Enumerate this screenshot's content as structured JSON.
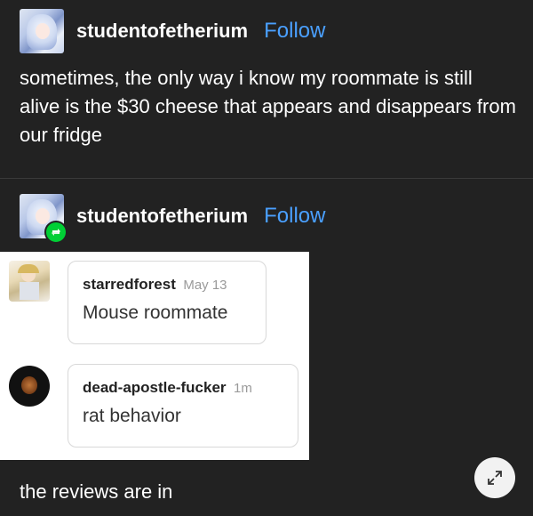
{
  "original_post": {
    "username": "studentofetherium",
    "follow_label": "Follow",
    "text": "sometimes, the only way i know my roommate is still alive is the $30 cheese that appears and disappears from our fridge"
  },
  "reblog_post": {
    "username": "studentofetherium",
    "follow_label": "Follow",
    "reblog_icon": "reblog-icon"
  },
  "comments": [
    {
      "name": "starredforest",
      "time": "May 13",
      "text": "Mouse roommate"
    },
    {
      "name": "dead-apostle-fucker",
      "time": "1m",
      "text": "rat behavior"
    }
  ],
  "caption": "the reviews are in",
  "expand_icon": "expand-icon",
  "colors": {
    "background": "#222222",
    "follow": "#4aa0ff",
    "reblog_badge": "#00cf35",
    "panel": "#ffffff"
  }
}
